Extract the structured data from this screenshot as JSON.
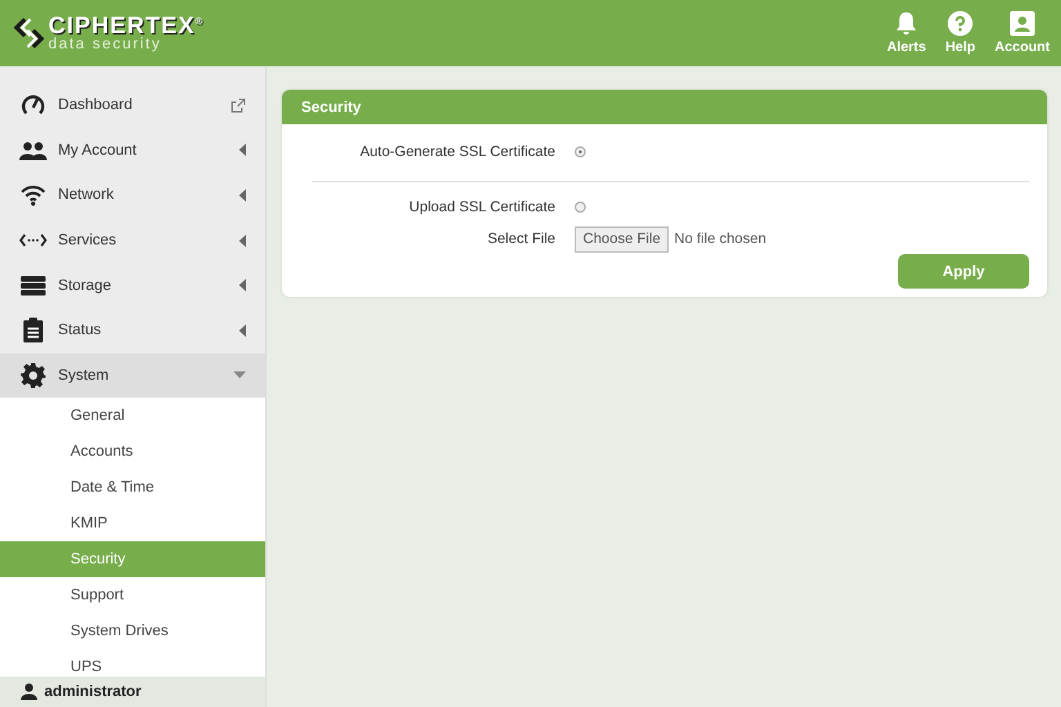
{
  "header": {
    "logo": {
      "name": "CIPHERTEX$^{®}$",
      "tagline": "data security"
    },
    "actions": [
      {
        "label": "Alerts"
      },
      {
        "label": "Help"
      },
      {
        "label": "Account"
      }
    ]
  },
  "sidebar": {
    "items": [
      {
        "label": "Dashboard",
        "kind": "link"
      },
      {
        "label": "My Account",
        "kind": "menu",
        "expanded": false
      },
      {
        "label": "Network",
        "kind": "menu",
        "expanded": false
      },
      {
        "label": "Services",
        "kind": "menu",
        "expanded": false
      },
      {
        "label": "Storage",
        "kind": "menu",
        "expanded": false
      },
      {
        "label": "Status",
        "kind": "menu",
        "expanded": false
      },
      {
        "label": "System",
        "kind": "menu",
        "expanded": true,
        "children": [
          {
            "label": "General",
            "selected": false
          },
          {
            "label": "Accounts",
            "selected": false
          },
          {
            "label": "Date & Time",
            "selected": false
          },
          {
            "label": "KMIP",
            "selected": false
          },
          {
            "label": "Security",
            "selected": true
          },
          {
            "label": "Support",
            "selected": false
          },
          {
            "label": "System Drives",
            "selected": false
          },
          {
            "label": "UPS",
            "selected": false
          }
        ]
      }
    ],
    "user": "administrator"
  },
  "panel": {
    "title": "Security",
    "auto_generate": {
      "label": "Auto-Generate SSL Certificate",
      "checked": true
    },
    "upload": {
      "label": "Upload SSL Certificate",
      "checked": false
    },
    "file": {
      "label": "Select File",
      "button": "Choose File",
      "status": "No file chosen"
    },
    "apply": "Apply"
  }
}
